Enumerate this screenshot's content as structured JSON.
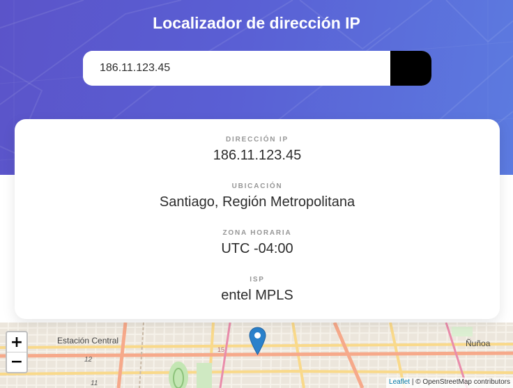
{
  "app": {
    "title": "Localizador de dirección IP"
  },
  "search": {
    "value": "186.11.123.45",
    "submit_icon": "chevron-right-icon"
  },
  "info": {
    "ip_label": "DIRECCIÓN IP",
    "ip_value": "186.11.123.45",
    "location_label": "UBICACIÓN",
    "location_value": "Santiago, Región Metropolitana",
    "timezone_label": "ZONA HORARIA",
    "timezone_value": "UTC -04:00",
    "isp_label": "ISP",
    "isp_value": "entel MPLS"
  },
  "map": {
    "zoom_in": "+",
    "zoom_out": "−",
    "labels": {
      "estacion_central": "Estación Central",
      "nunoa": "Ñuñoa",
      "label_12": "12",
      "label_11": "11",
      "label_15": "15"
    },
    "attribution_link": "Leaflet",
    "attribution_separator": "|",
    "attribution_text": "© OpenStreetMap contributors",
    "marker_icon": "map-marker-icon"
  },
  "colors": {
    "hero_start": "#5b54c9",
    "hero_end": "#5c7be0",
    "marker": "#2a81cb",
    "button": "#000000"
  }
}
